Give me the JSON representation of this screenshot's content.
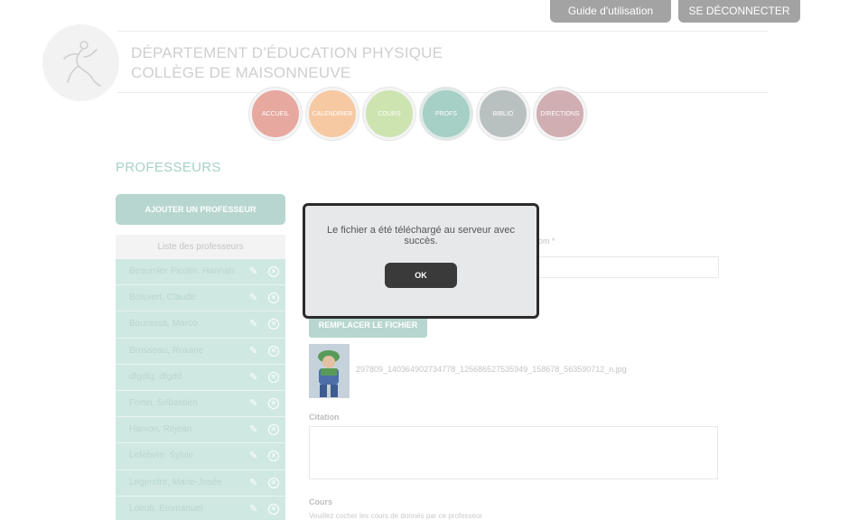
{
  "top_buttons": {
    "guide": "Guide d'utilisation",
    "logout": "SE DÉCONNECTER"
  },
  "header": {
    "line1": "DÉPARTEMENT D’ÉDUCATION PHYSIQUE",
    "line2": "COLLÈGE DE MAISONNEUVE"
  },
  "nav": [
    {
      "label": "ACCUEIL",
      "color": "#e7a89f"
    },
    {
      "label": "CALENDRIER",
      "color": "#f6c9a2"
    },
    {
      "label": "COURS",
      "color": "#cde4b1"
    },
    {
      "label": "PROFS",
      "color": "#a6cfc6",
      "active": true
    },
    {
      "label": "BIBLIO",
      "color": "#b9c1c0"
    },
    {
      "label": "DIRECTIONS",
      "color": "#d0aeb1"
    }
  ],
  "page_title": "PROFESSEURS",
  "add_button": "AJOUTER UN PROFESSEUR",
  "list_title": "Liste des professeurs",
  "professors": [
    "Beaumier Picotin, Hannah",
    "Boisvert, Claude",
    "Bourassa, Marco",
    "Brosseau, Roxane",
    "dfgdfg, dfgdd",
    "Fortin, Sébastien",
    "Hamon, Réjean",
    "Lefèbvre, Sylvie",
    "Legendre, Marie-Josée",
    "Loeub, Emmanuel"
  ],
  "form": {
    "name_label_partial": "om *",
    "replace_button": "REMPLACER LE FICHIER",
    "filename": "297809_140364902734778_125686527535949_158678_563590712_n.jpg",
    "citation_label": "Citation",
    "courses_label": "Cours",
    "courses_help": "Veuillez cocher les cours de donnés par ce professeur"
  },
  "modal": {
    "message": "Le fichier a été téléchargé au serveur avec succès.",
    "ok": "OK"
  },
  "icons": {
    "edit": "pencil-icon",
    "delete": "close-circle-icon",
    "logo": "runner-logo"
  }
}
